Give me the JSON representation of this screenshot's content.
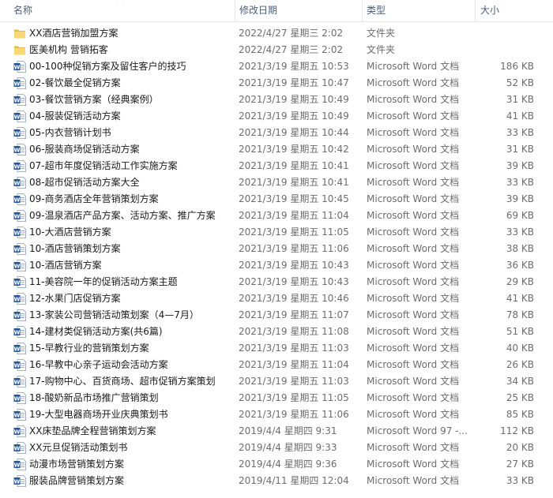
{
  "columns": {
    "name": "名称",
    "modified": "修改日期",
    "type": "类型",
    "size": "大小"
  },
  "sort_indicator": "^",
  "files": [
    {
      "icon": "folder-icon",
      "name": "XX酒店营销加盟方案",
      "modified": "2022/4/27 星期三 2:02",
      "type": "文件夹",
      "size": ""
    },
    {
      "icon": "folder-icon",
      "name": "医美机构 营销拓客",
      "modified": "2022/4/27 星期三 2:02",
      "type": "文件夹",
      "size": ""
    },
    {
      "icon": "word-doc-icon",
      "name": "00-100种促销方案及留住客户的技巧",
      "modified": "2021/3/19 星期五 10:53",
      "type": "Microsoft Word 文档",
      "size": "186 KB"
    },
    {
      "icon": "word-doc-icon",
      "name": "02-餐饮最全促销方案",
      "modified": "2021/3/19 星期五 10:47",
      "type": "Microsoft Word 文档",
      "size": "52 KB"
    },
    {
      "icon": "word-doc-icon",
      "name": "03-餐饮营销方案（经典案例）",
      "modified": "2021/3/19 星期五 10:49",
      "type": "Microsoft Word 文档",
      "size": "31 KB"
    },
    {
      "icon": "word-doc-icon",
      "name": "04-服装促销活动方案",
      "modified": "2021/3/19 星期五 10:49",
      "type": "Microsoft Word 文档",
      "size": "41 KB"
    },
    {
      "icon": "word-doc-icon",
      "name": "05-内衣营销计划书",
      "modified": "2021/3/19 星期五 10:44",
      "type": "Microsoft Word 文档",
      "size": "33 KB"
    },
    {
      "icon": "word-doc-icon",
      "name": "06-服装商场促销活动方案",
      "modified": "2021/3/19 星期五 10:42",
      "type": "Microsoft Word 文档",
      "size": "31 KB"
    },
    {
      "icon": "word-doc-icon",
      "name": "07-超市年度促销活动工作实施方案",
      "modified": "2021/3/19 星期五 10:41",
      "type": "Microsoft Word 文档",
      "size": "39 KB"
    },
    {
      "icon": "word-doc-icon",
      "name": "08-超市促销活动方案大全",
      "modified": "2021/3/19 星期五 10:41",
      "type": "Microsoft Word 文档",
      "size": "33 KB"
    },
    {
      "icon": "word-doc-icon",
      "name": "09-商务酒店全年营销策划方案",
      "modified": "2021/3/19 星期五 10:45",
      "type": "Microsoft Word 文档",
      "size": "39 KB"
    },
    {
      "icon": "word-doc-icon",
      "name": "09-温泉酒店产品方案、活动方案、推广方案",
      "modified": "2021/3/19 星期五 11:04",
      "type": "Microsoft Word 文档",
      "size": "69 KB"
    },
    {
      "icon": "word-doc-icon",
      "name": "10-大酒店营销方案",
      "modified": "2021/3/19 星期五 11:05",
      "type": "Microsoft Word 文档",
      "size": "33 KB"
    },
    {
      "icon": "word-doc-icon",
      "name": "10-酒店营销策划方案",
      "modified": "2021/3/19 星期五 11:06",
      "type": "Microsoft Word 文档",
      "size": "38 KB"
    },
    {
      "icon": "word-doc-icon",
      "name": "10-酒店营销方案",
      "modified": "2021/3/19 星期五 10:43",
      "type": "Microsoft Word 文档",
      "size": "36 KB"
    },
    {
      "icon": "word-doc-icon",
      "name": "11-美容院一年的促销活动方案主题",
      "modified": "2021/3/19 星期五 10:43",
      "type": "Microsoft Word 文档",
      "size": "29 KB"
    },
    {
      "icon": "word-doc-icon",
      "name": "12-水果门店促销方案",
      "modified": "2021/3/19 星期五 10:46",
      "type": "Microsoft Word 文档",
      "size": "41 KB"
    },
    {
      "icon": "word-doc-icon",
      "name": "13-家装公司营销活动策划案（4—7月）",
      "modified": "2021/3/19 星期五 11:07",
      "type": "Microsoft Word 文档",
      "size": "78 KB"
    },
    {
      "icon": "word-doc-icon",
      "name": "14-建材类促销活动方案(共6篇)",
      "modified": "2021/3/19 星期五 11:08",
      "type": "Microsoft Word 文档",
      "size": "51 KB"
    },
    {
      "icon": "word-doc-icon",
      "name": "15-早教行业的营销策划方案",
      "modified": "2021/3/19 星期五 11:03",
      "type": "Microsoft Word 文档",
      "size": "40 KB"
    },
    {
      "icon": "word-doc-icon",
      "name": "16-早教中心亲子运动会活动方案",
      "modified": "2021/3/19 星期五 11:04",
      "type": "Microsoft Word 文档",
      "size": "26 KB"
    },
    {
      "icon": "word-doc-icon",
      "name": "17-购物中心、百货商场、超市促销方案策划",
      "modified": "2021/3/19 星期五 11:03",
      "type": "Microsoft Word 文档",
      "size": "34 KB"
    },
    {
      "icon": "word-doc-icon",
      "name": "18-酸奶新品市场推广营销策划",
      "modified": "2021/3/19 星期五 11:05",
      "type": "Microsoft Word 文档",
      "size": "25 KB"
    },
    {
      "icon": "word-doc-icon",
      "name": "19-大型电器商场开业庆典策划书",
      "modified": "2021/3/19 星期五 11:06",
      "type": "Microsoft Word 文档",
      "size": "85 KB"
    },
    {
      "icon": "word-doc-icon",
      "name": "XX床垫品牌全程营销策划方案",
      "modified": "2019/4/4 星期四 9:31",
      "type": "Microsoft Word 97 -...",
      "size": "112 KB"
    },
    {
      "icon": "word-doc-icon",
      "name": "XX元旦促销活动策划书",
      "modified": "2019/4/4 星期四 9:33",
      "type": "Microsoft Word 文档",
      "size": "20 KB"
    },
    {
      "icon": "word-doc-icon",
      "name": "动漫市场营销策划方案",
      "modified": "2019/4/4 星期四 9:36",
      "type": "Microsoft Word 文档",
      "size": "27 KB"
    },
    {
      "icon": "word-doc-icon",
      "name": "服装品牌营销策划方案",
      "modified": "2019/4/11 星期四 12:04",
      "type": "Microsoft Word 文档",
      "size": "33 KB"
    }
  ]
}
